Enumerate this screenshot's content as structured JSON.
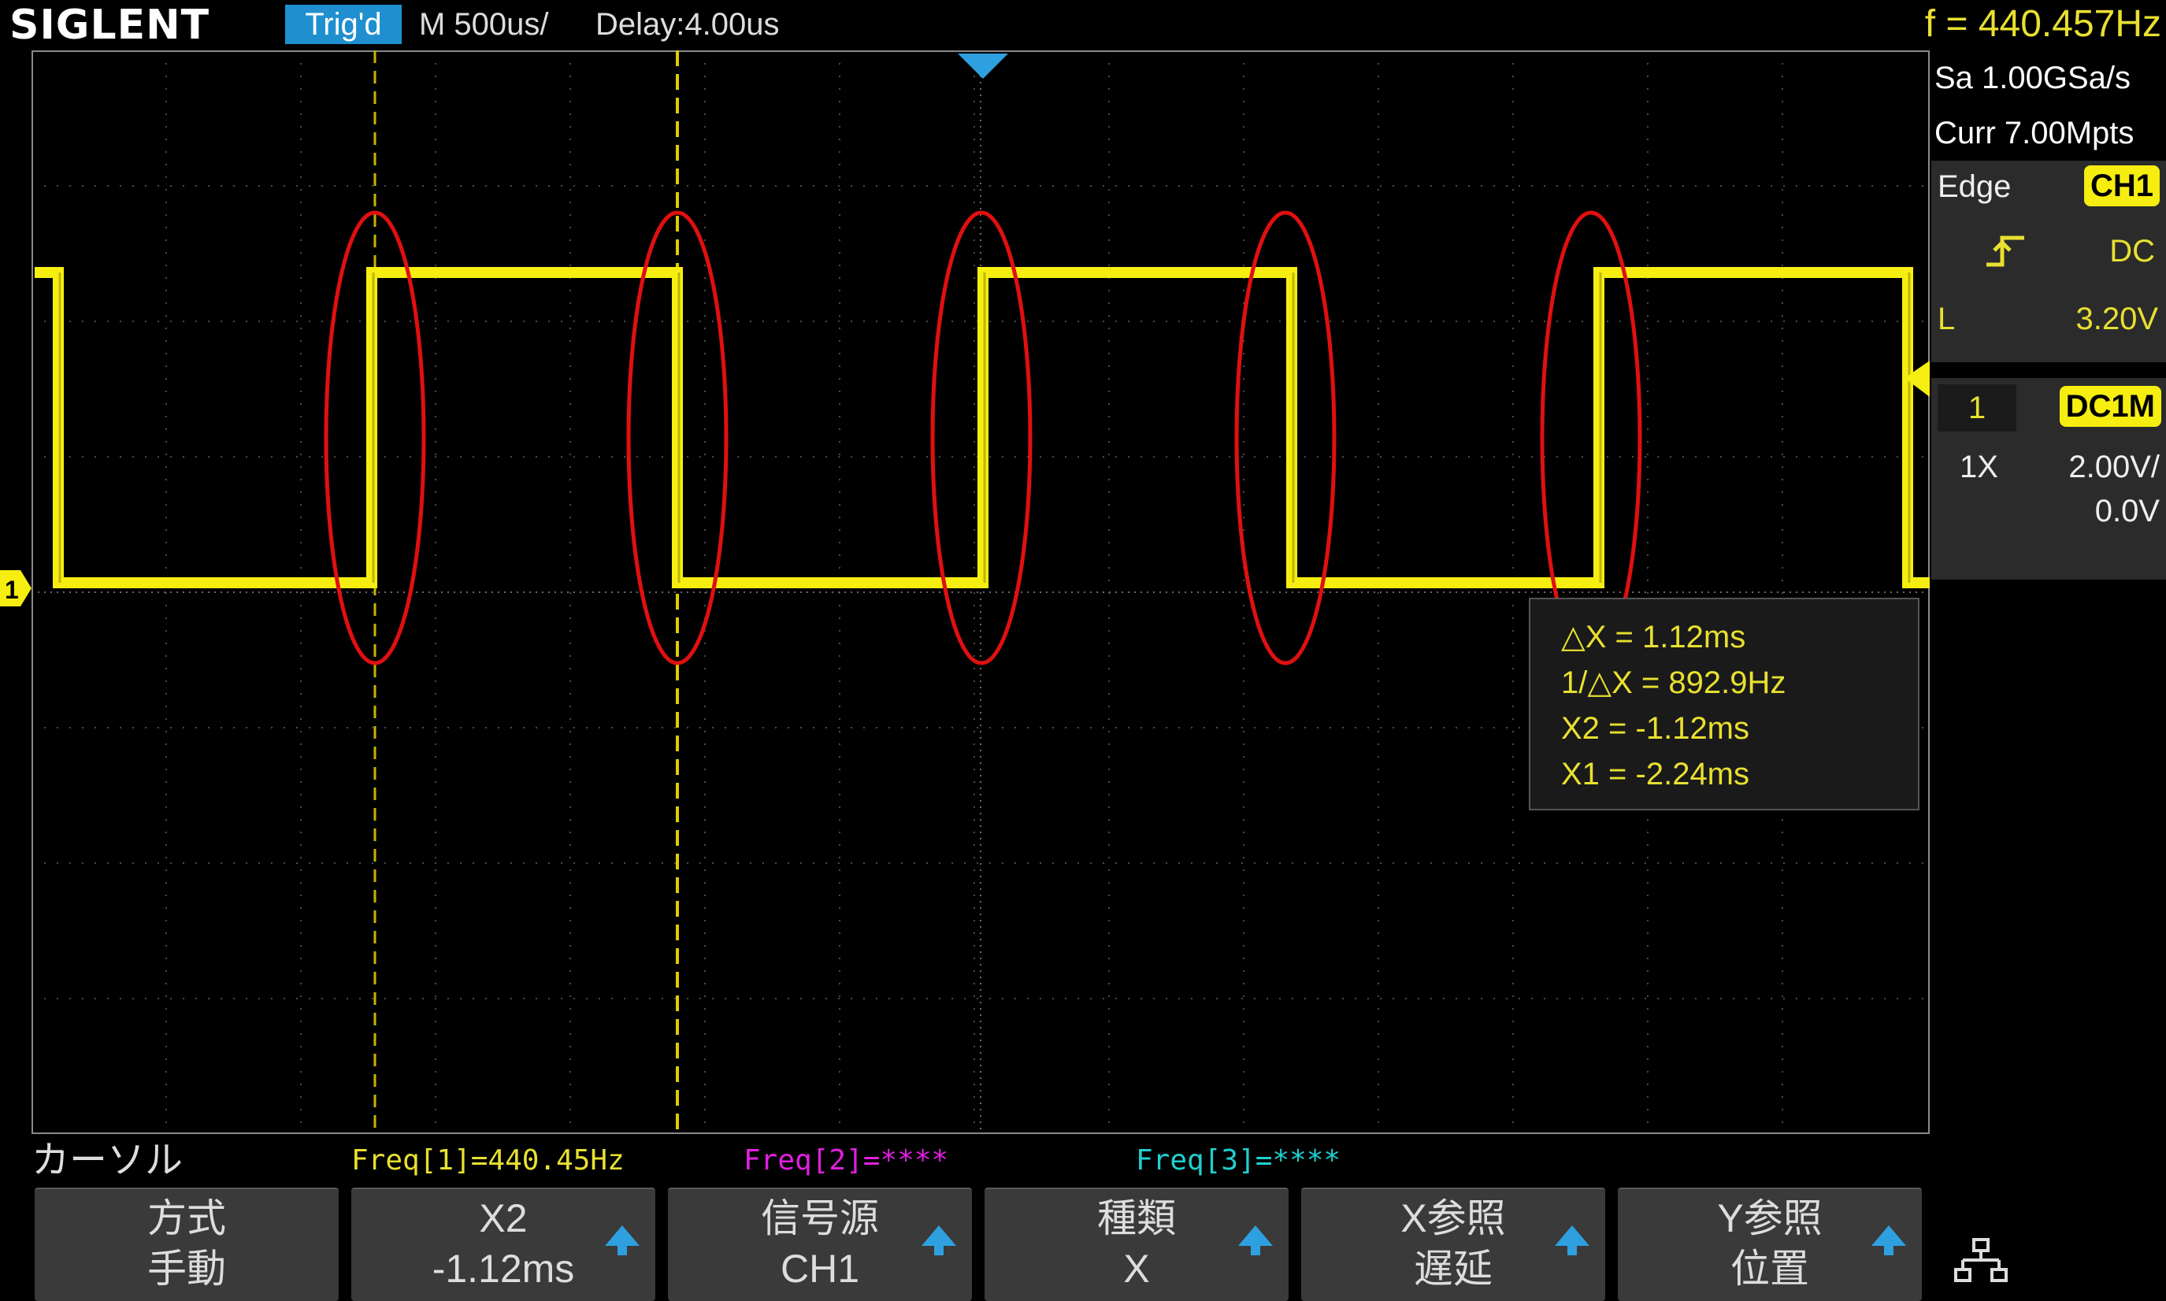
{
  "topbar": {
    "logo": "SIGLENT",
    "trig_status": "Trig'd",
    "timebase": "M 500us/",
    "delay": "Delay:4.00us",
    "frequency": "f = 440.457Hz"
  },
  "right_panel": {
    "sample_rate": "Sa 1.00GSa/s",
    "memory_depth": "Curr 7.00Mpts",
    "trigger": {
      "type": "Edge",
      "source": "CH1",
      "coupling": "DC",
      "level_label": "L",
      "level": "3.20V",
      "slope_icon": "rising-edge-icon"
    },
    "channel": {
      "number": "1",
      "coupling_badge": "DC1M",
      "probe": "1X",
      "scale": "2.00V/",
      "offset": "0.0V"
    }
  },
  "cursor_readout": {
    "delta_x": "△X = 1.12ms",
    "inv_delta_x": "1/△X = 892.9Hz",
    "x2": "X2 = -1.12ms",
    "x1": "X1 = -2.24ms"
  },
  "channel_marker": "1",
  "bottom": {
    "menu_title": "カーソル",
    "freq1": "Freq[1]=440.45Hz",
    "freq2": "Freq[2]=****",
    "freq3": "Freq[3]=****"
  },
  "softkeys": [
    {
      "line1": "方式",
      "line2": "手動"
    },
    {
      "line1": "X2",
      "line2": "-1.12ms"
    },
    {
      "line1": "信号源",
      "line2": "CH1"
    },
    {
      "line1": "種類",
      "line2": "X"
    },
    {
      "line1": "X参照",
      "line2": "遅延"
    },
    {
      "line1": "Y参照",
      "line2": "位置"
    }
  ],
  "colors": {
    "ch1": "#f6ee10",
    "cursor": "#c8b400",
    "annotation": "#e01010",
    "trigger_badge": "#1f8fd0",
    "freq2": "#e020e0",
    "freq3": "#20d0d0"
  },
  "icons": [
    "menu-tree-icon",
    "trigger-position-icon",
    "trigger-level-icon",
    "channel-1-marker-icon"
  ]
}
